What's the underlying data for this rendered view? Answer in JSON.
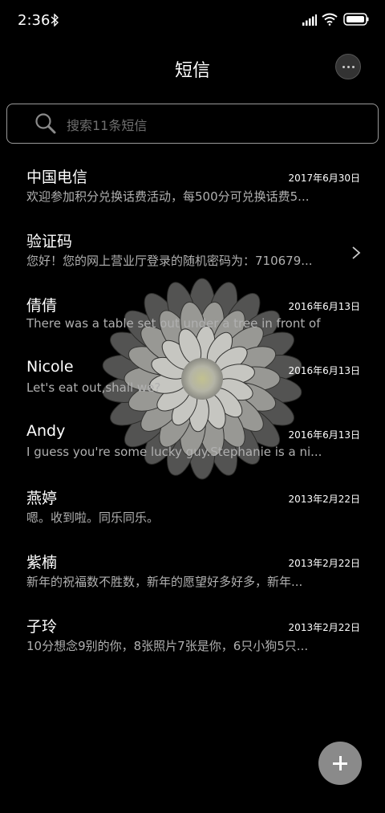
{
  "status_bar": {
    "time": "2:36"
  },
  "header": {
    "title": "短信"
  },
  "search": {
    "placeholder": "搜索11条短信"
  },
  "messages": [
    {
      "name": "中国电信",
      "date": "2017年6月30日",
      "preview": "欢迎参加积分兑换话费活动，每500分可兑换话费5..."
    },
    {
      "name": "验证码",
      "date": "",
      "preview": "您好！您的网上营业厅登录的随机密码为：710679..."
    },
    {
      "name": "倩倩",
      "date": "2016年6月13日",
      "preview": "There was a table set out under a tree in front of ..."
    },
    {
      "name": "Nicole",
      "date": "2016年6月13日",
      "preview": "Let's eat out,shall we?"
    },
    {
      "name": "Andy",
      "date": "2016年6月13日",
      "preview": "I guess you're some lucky guy.Stephanie is a ni..."
    },
    {
      "name": "燕婷",
      "date": "2013年2月22日",
      "preview": "嗯。收到啦。同乐同乐。"
    },
    {
      "name": "紫楠",
      "date": "2013年2月22日",
      "preview": "新年的祝福数不胜数，新年的愿望好多好多，新年..."
    },
    {
      "name": "子玲",
      "date": "2013年2月22日",
      "preview": "10分想念9别的你，8张照片7张是你，6只小狗5只..."
    }
  ],
  "icons": {
    "bluetooth": "bluetooth-icon",
    "signal": "signal-icon",
    "wifi": "wifi-icon",
    "battery": "battery-icon",
    "more": "more-icon",
    "search": "search-icon",
    "chevron": "chevron-right-icon",
    "add": "plus-icon",
    "wallpaper": "flower-wallpaper"
  },
  "colors": {
    "background": "#000000",
    "text_primary": "#ffffff",
    "text_secondary": "#b0b0b0",
    "fab": "#8a8a8a"
  }
}
